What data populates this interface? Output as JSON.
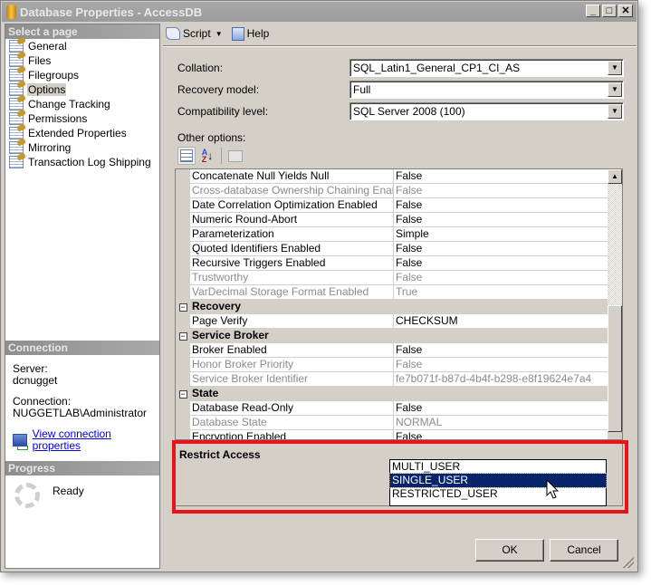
{
  "window": {
    "title": "Database Properties - AccessDB",
    "controls": [
      "minimize",
      "maximize",
      "close"
    ]
  },
  "left_panel": {
    "select_page_header": "Select a page",
    "pages": [
      {
        "label": "General",
        "selected": false
      },
      {
        "label": "Files",
        "selected": false
      },
      {
        "label": "Filegroups",
        "selected": false
      },
      {
        "label": "Options",
        "selected": true
      },
      {
        "label": "Change Tracking",
        "selected": false
      },
      {
        "label": "Permissions",
        "selected": false
      },
      {
        "label": "Extended Properties",
        "selected": false
      },
      {
        "label": "Mirroring",
        "selected": false
      },
      {
        "label": "Transaction Log Shipping",
        "selected": false
      }
    ],
    "connection_header": "Connection",
    "server_label": "Server:",
    "server_value": "dcnugget",
    "connection_label": "Connection:",
    "connection_value": "NUGGETLAB\\Administrator",
    "view_connection_link": "View connection properties",
    "progress_header": "Progress",
    "progress_status": "Ready"
  },
  "toolbar": {
    "script_label": "Script",
    "help_label": "Help"
  },
  "form": {
    "collation_label": "Collation:",
    "collation_value": "SQL_Latin1_General_CP1_CI_AS",
    "recovery_label": "Recovery model:",
    "recovery_value": "Full",
    "compat_label": "Compatibility level:",
    "compat_value": "SQL Server 2008 (100)",
    "other_options_label": "Other options:"
  },
  "property_grid": {
    "rows": [
      {
        "type": "prop",
        "name": "Concatenate Null Yields Null",
        "value": "False",
        "dim": false
      },
      {
        "type": "prop",
        "name": "Cross-database Ownership Chaining Enabled",
        "value": "False",
        "dim": true
      },
      {
        "type": "prop",
        "name": "Date Correlation Optimization Enabled",
        "value": "False",
        "dim": false
      },
      {
        "type": "prop",
        "name": "Numeric Round-Abort",
        "value": "False",
        "dim": false
      },
      {
        "type": "prop",
        "name": "Parameterization",
        "value": "Simple",
        "dim": false
      },
      {
        "type": "prop",
        "name": "Quoted Identifiers Enabled",
        "value": "False",
        "dim": false
      },
      {
        "type": "prop",
        "name": "Recursive Triggers Enabled",
        "value": "False",
        "dim": false
      },
      {
        "type": "prop",
        "name": "Trustworthy",
        "value": "False",
        "dim": true
      },
      {
        "type": "prop",
        "name": "VarDecimal Storage Format Enabled",
        "value": "True",
        "dim": true
      },
      {
        "type": "category",
        "name": "Recovery"
      },
      {
        "type": "prop",
        "name": "Page Verify",
        "value": "CHECKSUM",
        "dim": false
      },
      {
        "type": "category",
        "name": "Service Broker"
      },
      {
        "type": "prop",
        "name": "Broker Enabled",
        "value": "False",
        "dim": false
      },
      {
        "type": "prop",
        "name": "Honor Broker Priority",
        "value": "False",
        "dim": true
      },
      {
        "type": "prop",
        "name": "Service Broker Identifier",
        "value": "fe7b071f-b87d-4b4f-b298-e8f19624e7a4",
        "dim": true
      },
      {
        "type": "category",
        "name": "State"
      },
      {
        "type": "prop",
        "name": "Database Read-Only",
        "value": "False",
        "dim": false
      },
      {
        "type": "prop",
        "name": "Database State",
        "value": "NORMAL",
        "dim": true
      },
      {
        "type": "prop",
        "name": "Encryption Enabled",
        "value": "False",
        "dim": false
      },
      {
        "type": "prop",
        "name": "Restrict Access",
        "value": "SINGLE_USER",
        "dim": false,
        "selected": true
      }
    ]
  },
  "restrict_access_dropdown": {
    "options": [
      "MULTI_USER",
      "SINGLE_USER",
      "RESTRICTED_USER"
    ],
    "selected": "SINGLE_USER"
  },
  "description": {
    "title": "Restrict Access"
  },
  "buttons": {
    "ok": "OK",
    "cancel": "Cancel"
  },
  "annotation": {
    "highlight_color": "#e8141a"
  }
}
